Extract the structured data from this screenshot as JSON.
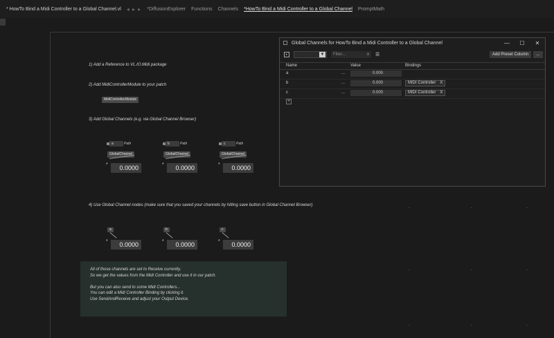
{
  "topbar": {
    "doc_title": "* HowTo Bind a Midi Controller to a Global Channel.vl",
    "nav_arrows": "◂ ▸ ▸",
    "tabs": [
      "*DiffusionExplorer",
      "Functions",
      "Channels",
      "*HowTo Bind a Midi Controller to a Global Channel",
      "PromptMath"
    ]
  },
  "patch": {
    "step1": "1) Add a Reference to VL.IO.Midi package",
    "step2": "2) Add MidiControllerModule to your patch",
    "midi_node": "MidiControllerModule",
    "step3": "3) Add Global Channels (e.g. via Global Channel Browser)",
    "channel_node": "GlobalChannel",
    "path_label": "Path",
    "star": "*",
    "channels": [
      {
        "name": "a",
        "value": "0.0000"
      },
      {
        "name": "b",
        "value": "0.0000"
      },
      {
        "name": "c",
        "value": "0.0000"
      }
    ],
    "step4": "4) Use Global Channel nodes (make sure that you saved your channels by hitting save button in Global Channel Browser)",
    "note_lines": [
      "All of those channels are set to Receive currently.",
      "So we get the values from the Midi Controller and use it in our patch.",
      "",
      "But you can also send to some Midi Controllers...",
      "You can edit a Midi Controller Binding by clicking it.",
      "Use SendAndReceive and adjust your Output Device."
    ]
  },
  "window": {
    "title": "Global Channels for HowTo Bind a Midi Controller to a Global Channel",
    "minimize": "—",
    "maximize": "☐",
    "close": "✕",
    "filter_placeholder": "Filter...",
    "filter_clear": "x",
    "add_preset": "Add Preset Column",
    "more": "...",
    "columns": {
      "name": "Name",
      "value": "Value",
      "bindings": "Bindings"
    },
    "rows": [
      {
        "name": "a",
        "dots": "...",
        "value": "0.000",
        "binding": ""
      },
      {
        "name": "b",
        "dots": "...",
        "value": "0.000",
        "binding": "MIDI Controller"
      },
      {
        "name": "c",
        "dots": "...",
        "value": "0.000",
        "binding": "MIDI Controller"
      }
    ],
    "binding_remove": "X",
    "add_row": "+"
  }
}
